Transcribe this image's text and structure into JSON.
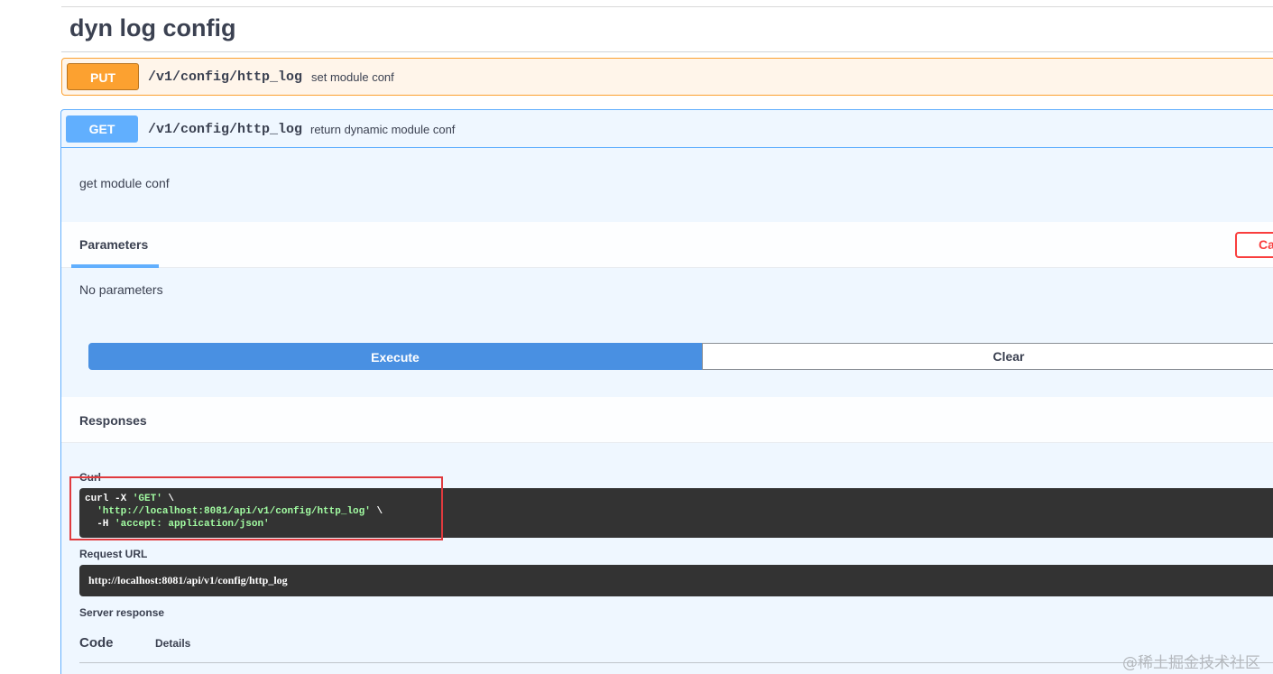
{
  "section": {
    "title": "dyn log config"
  },
  "put_operation": {
    "method": "PUT",
    "path": "/v1/config/http_log",
    "summary": "set module conf"
  },
  "get_operation": {
    "method": "GET",
    "path": "/v1/config/http_log",
    "summary": "return dynamic module conf",
    "description": "get module conf",
    "parameters_tab": "Parameters",
    "cancel_label": "Ca",
    "no_parameters": "No parameters",
    "execute_label": "Execute",
    "clear_label": "Clear",
    "responses_label": "Responses",
    "curl_label": "Curl",
    "curl": {
      "line1_prefix": "curl -X ",
      "method_str": "'GET'",
      "line1_suffix": " \\",
      "line2_indent": "  ",
      "url_str": "'http://localhost:8081/api/v1/config/http_log'",
      "line2_suffix": " \\",
      "line3_prefix": "  -H ",
      "header_str": "'accept: application/json'"
    },
    "request_url_label": "Request URL",
    "request_url": "http://localhost:8081/api/v1/config/http_log",
    "server_response_label": "Server response",
    "code_col": "Code",
    "details_col": "Details"
  },
  "watermark": "@稀土掘金技术社区",
  "colors": {
    "put": "#fca130",
    "get": "#61affe",
    "execute": "#4990e2",
    "cancel": "#f93e3e",
    "highlight": "#e03a3e"
  }
}
